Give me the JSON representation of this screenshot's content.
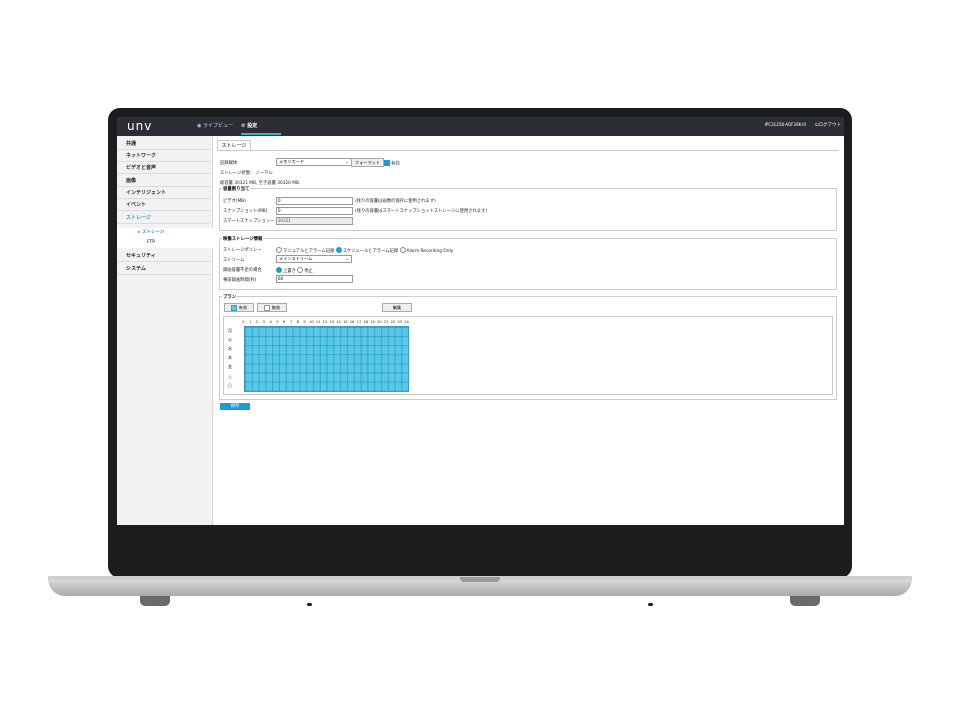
{
  "header": {
    "logo": "unv",
    "nav_live": "◉ ライブビュー",
    "nav_settings": "⚙ 設定",
    "model": "IPC3125B-ADF28K-I0",
    "logout": "⏻ログアウト"
  },
  "sidebar": {
    "items": [
      {
        "label": "共通"
      },
      {
        "label": "ネットワーク"
      },
      {
        "label": "ビデオと音声"
      },
      {
        "label": "画像"
      },
      {
        "label": "インテリジェント"
      },
      {
        "label": "イベント"
      },
      {
        "label": "ストレージ"
      }
    ],
    "subitems": [
      {
        "label": "▸ ストレージ"
      },
      {
        "label": "FTP"
      }
    ],
    "items_after": [
      {
        "label": "セキュリティ"
      },
      {
        "label": "システム"
      }
    ]
  },
  "tab": {
    "label": "ストレージ"
  },
  "storage": {
    "media_label": "記録媒体",
    "media_value": "メモリカード",
    "format_button": "フォーマット",
    "enable_label": "有効",
    "status_text": "ストレージ状態： ノーマル",
    "capacity_text": "総容量 30321 MB, 空き容量 30320 MB."
  },
  "allocation": {
    "legend": "容量割り当て",
    "video_label": "ビデオ(MB)",
    "video_value": "0",
    "video_note": "(残りの容量は画像の保存に使用されます)",
    "snapshot_label": "スナップショット(MB)",
    "snapshot_value": "0",
    "snapshot_note": "(残りの容量はスマートスナップショットストレージに使用されます)",
    "smart_label": "スマートスナップショッー",
    "smart_value": "30321"
  },
  "video_storage": {
    "legend": "映像ストレージ情報",
    "policy_label": "ストレージポリシー",
    "policy_options": [
      "マニュアルとアラーム記録",
      "スケジュールとアラーム記録",
      "Alarm Recording Only"
    ],
    "stream_label": "ストリーム",
    "stream_value": "メインストリーム",
    "full_label": "録画容量不足の場合",
    "full_options": [
      "上書き",
      "停止"
    ],
    "pre_label": "事前録画時間(秒)",
    "pre_value": "60"
  },
  "plan": {
    "legend": "プラン",
    "enable_button": "有効",
    "disable_button": "無効",
    "edit_button": "編集",
    "hours": [
      "0",
      "1",
      "2",
      "3",
      "4",
      "5",
      "6",
      "7",
      "8",
      "9",
      "10",
      "11",
      "12",
      "13",
      "14",
      "15",
      "16",
      "17",
      "18",
      "19",
      "20",
      "21",
      "22",
      "23",
      "24"
    ],
    "days": [
      "月",
      "火",
      "水",
      "木",
      "金",
      "土",
      "日"
    ]
  },
  "save_button": "保存",
  "colors": {
    "accent": "#1e9bd7",
    "schedule": "#56c8ea",
    "topbar": "#2b2e33"
  }
}
